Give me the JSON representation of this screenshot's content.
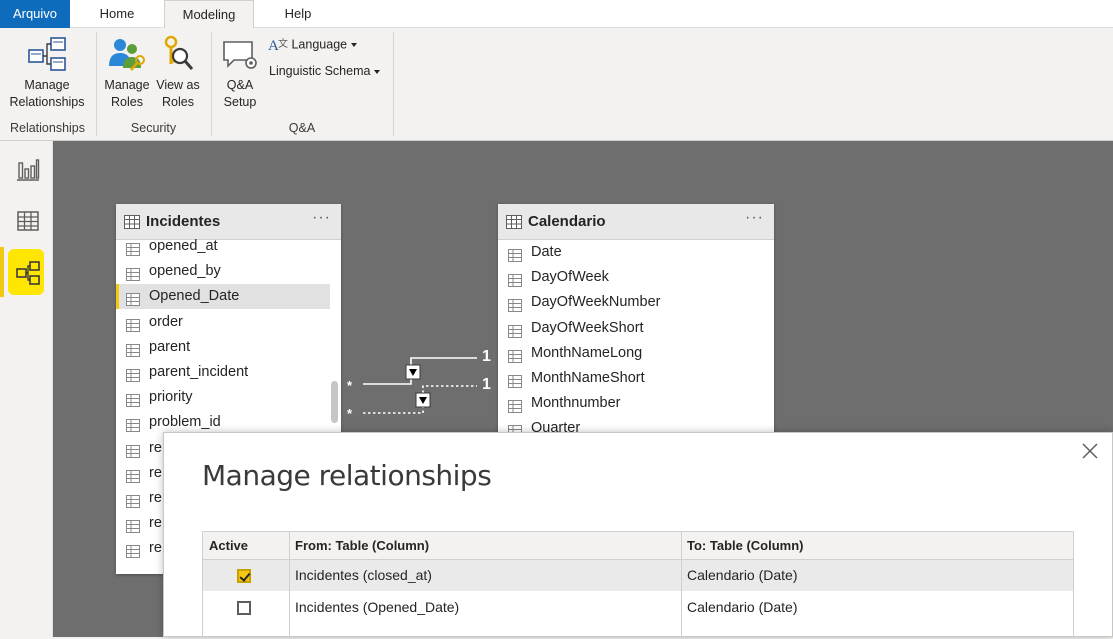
{
  "tabs": {
    "file": "Arquivo",
    "home": "Home",
    "modeling": "Modeling",
    "help": "Help"
  },
  "ribbon": {
    "relationships": {
      "button_line1": "Manage",
      "button_line2": "Relationships",
      "group": "Relationships"
    },
    "security": {
      "manage_roles_line1": "Manage",
      "manage_roles_line2": "Roles",
      "view_as_line1": "View as",
      "view_as_line2": "Roles",
      "group": "Security"
    },
    "qa": {
      "setup_line1": "Q&A",
      "setup_line2": "Setup",
      "language": "Language",
      "linguistic_schema": "Linguistic Schema",
      "group": "Q&A"
    }
  },
  "leftnav": {
    "items": [
      "report-icon",
      "data-icon",
      "model-icon"
    ],
    "active": "model-icon"
  },
  "incidentes": {
    "title": "Incidentes",
    "more": "···",
    "fields": [
      "opened_at",
      "opened_by",
      "Opened_Date",
      "order",
      "parent",
      "parent_incident",
      "priority",
      "problem_id",
      "re",
      "re",
      "re",
      "re",
      "re"
    ],
    "selected": "Opened_Date"
  },
  "calendario": {
    "title": "Calendario",
    "more": "···",
    "fields": [
      "Date",
      "DayOfWeek",
      "DayOfWeekNumber",
      "DayOfWeekShort",
      "MonthNameLong",
      "MonthNameShort",
      "Monthnumber",
      "Quarter"
    ]
  },
  "connectors": {
    "one_a": "1",
    "one_b": "1",
    "many_a": "*",
    "many_b": "*"
  },
  "dialog": {
    "title": "Manage relationships",
    "headers": {
      "active": "Active",
      "from": "From: Table (Column)",
      "to": "To: Table (Column)"
    },
    "rows": [
      {
        "active": true,
        "from": "Incidentes (closed_at)",
        "to": "Calendario (Date)"
      },
      {
        "active": false,
        "from": "Incidentes (Opened_Date)",
        "to": "Calendario (Date)"
      }
    ]
  },
  "colors": {
    "accent_yellow": "#f2c811",
    "file_tab_blue": "#0f6cbd",
    "canvas_gray": "#6e6e6e"
  }
}
